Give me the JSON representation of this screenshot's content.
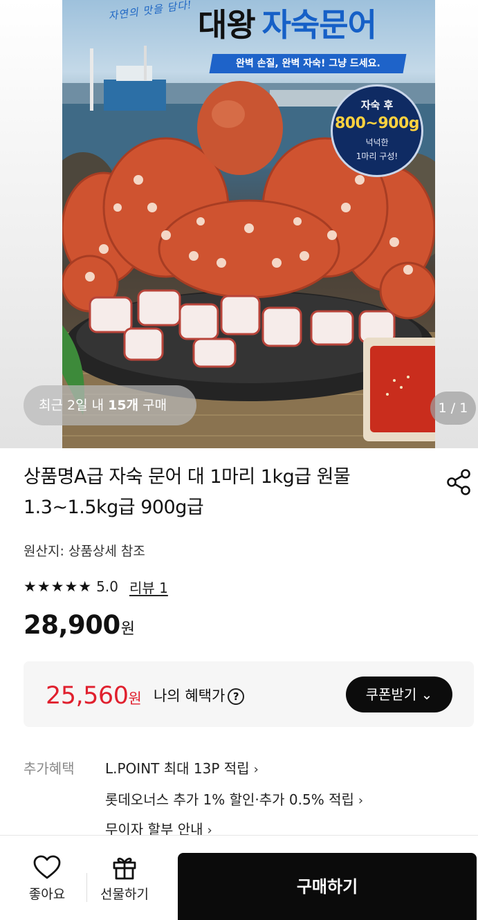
{
  "hero": {
    "banner_small": "자연의 맛을 담다!",
    "banner_title_1": "대왕",
    "banner_title_2": "자숙문어",
    "banner_sub": "완벽 손질, 완벽 자숙! 그냥 드세요.",
    "badge_line1": "자숙 후",
    "badge_line2": "800~900g",
    "badge_line3": "넉넉한",
    "badge_line4": "1마리 구성!",
    "recent_prefix": "최근 2일 내 ",
    "recent_count": "15개",
    "recent_suffix": " 구매",
    "counter": "1 / 1"
  },
  "product": {
    "title": "상품명A급 자숙 문어 대 1마리 1kg급 원물 1.3~1.5kg급 900g급",
    "origin": "원산지: 상품상세 참조",
    "stars": "★★★★★",
    "rating_value": 5.0,
    "rating_text": "5.0",
    "review_link": "리뷰 1",
    "price": "28,900",
    "price_unit": "원"
  },
  "benefit": {
    "price": "25,560",
    "price_unit": "원",
    "label": "나의 혜택가",
    "help_symbol": "?",
    "coupon_button": "쿠폰받기 ⌄"
  },
  "extra": {
    "label": "추가혜택",
    "rows": [
      "L.POINT 최대 13P 적립",
      "롯데오너스 추가 1% 할인·추가 0.5% 적립",
      "무이자 할부 안내"
    ],
    "chevron": "›"
  },
  "bottom": {
    "like_label": "좋아요",
    "gift_label": "선물하기",
    "buy_label": "구매하기"
  },
  "colors": {
    "accent_red": "#e0202e",
    "brand_blue": "#1e63c9",
    "buy_button": "#0b0b0b"
  }
}
